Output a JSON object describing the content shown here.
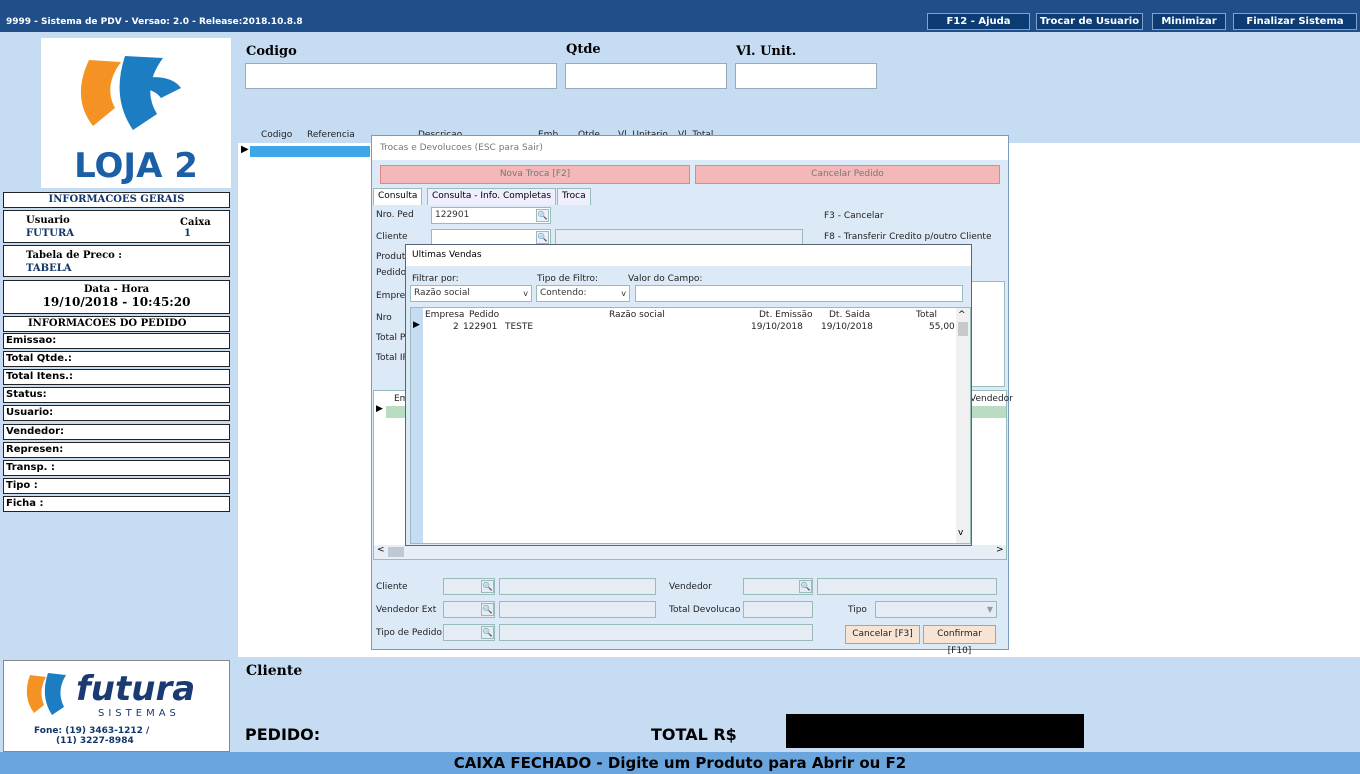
{
  "window": {
    "title": "9999 - Sistema de PDV - Versao: 2.0 - Release:2018.10.8.8",
    "buttons": [
      "F12 - Ajuda",
      "Trocar de Usuario",
      "Minimizar",
      "Finalizar Sistema"
    ]
  },
  "logo": {
    "brand_text": "LOJA 2"
  },
  "info": {
    "geral_title": "INFORMACOES GERAIS",
    "usuario_label": "Usuario",
    "usuario_value": "FUTURA",
    "caixa_label": "Caixa",
    "caixa_value": "1",
    "tabela_label": "Tabela de Preco :",
    "tabela_value": "TABELA",
    "datahora_label": "Data - Hora",
    "datahora_value": "19/10/2018 - 10:45:20",
    "pedido_title": "INFORMACOES DO PEDIDO",
    "rows": [
      "Emissao:",
      "Total Qtde.:",
      "Total Itens.:",
      "Status:",
      "Usuario:",
      "Vendedor:",
      "Represen:",
      "Transp. :",
      "Tipo :",
      "Ficha :"
    ]
  },
  "footer_logo": {
    "text": "futura",
    "sub": "SISTEMAS",
    "phone1": "Fone: (19) 3463-1212 /",
    "phone2": "(11) 3227-8984"
  },
  "entry": {
    "codigo_label": "Codigo",
    "qtde_label": "Qtde",
    "vlunit_label": "Vl. Unit."
  },
  "grid": {
    "headers": [
      "Codigo",
      "Referencia",
      "Descricao",
      "Emb",
      "Qtde",
      "Vl. Unitario",
      "Vl. Total"
    ]
  },
  "bottom": {
    "cliente_label": "Cliente",
    "pedido_label": "PEDIDO:",
    "total_label": "TOTAL R$",
    "status": "CAIXA FECHADO - Digite um Produto para Abrir ou F2"
  },
  "trocas": {
    "title": "Trocas e Devolucoes (ESC para Sair)",
    "nova_btn": "Nova Troca [F2]",
    "cancelar_pedido_btn": "Cancelar Pedido",
    "tabs": [
      "Consulta",
      "Consulta - Info. Completas",
      "Troca"
    ],
    "nro_ped_label": "Nro. Ped",
    "nro_ped_value": "122901",
    "cliente_label": "Cliente",
    "produto_label": "Produto",
    "pedido_label": "Pedido",
    "empresa_label": "Empresa",
    "nro_label": "Nro",
    "totalp_label": "Total P",
    "totali_label": "Total IP",
    "f3_hint": "F3 - Cancelar",
    "f8_hint": "F8 - Transferir Credito p/outro Cliente",
    "grid_col_emp": "Emp",
    "grid_col_vendedor": "Vendedor",
    "bottom": {
      "cliente": "Cliente",
      "vendedor": "Vendedor",
      "vendedor_ext": "Vendedor Ext",
      "total_devolucao": "Total Devolucao",
      "tipo": "Tipo",
      "tipo_pedido": "Tipo de Pedido",
      "cancelar_btn": "Cancelar [F3]",
      "confirmar_btn": "Confirmar [F10]"
    }
  },
  "ultimas": {
    "title": "Ultimas Vendas",
    "filtrar_label": "Filtrar por:",
    "filtrar_value": "Razão social",
    "tipo_label": "Tipo de Filtro:",
    "tipo_value": "Contendo:",
    "valor_label": "Valor do Campo:",
    "valor_value": "",
    "columns": [
      "Empresa",
      "Pedido",
      "Razão social",
      "Dt. Emissão",
      "Dt. Saida",
      "Total"
    ],
    "rows": [
      {
        "empresa": "2",
        "pedido": "122901",
        "razao": "TESTE",
        "emissao": "19/10/2018",
        "saida": "19/10/2018",
        "total": "55,00"
      }
    ]
  }
}
